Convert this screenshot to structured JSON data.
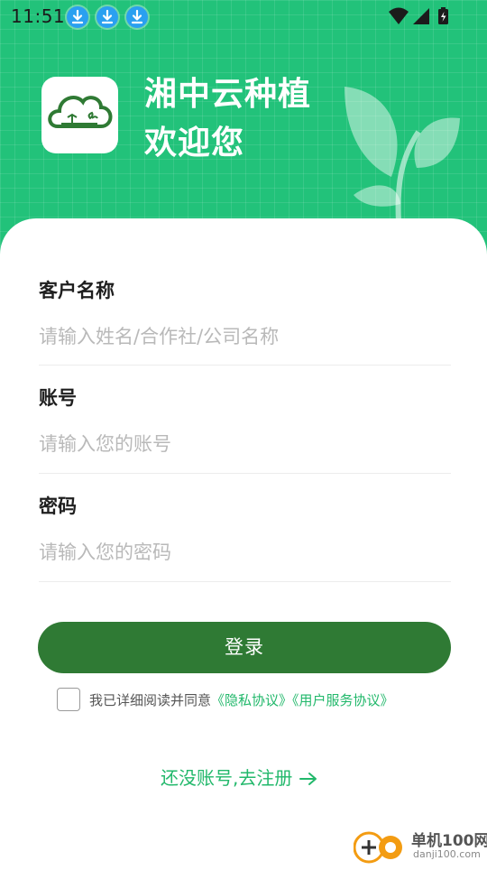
{
  "status_bar": {
    "time": "11:51",
    "notification_icons": [
      "download-icon",
      "download-icon",
      "download-icon"
    ],
    "right_icons": [
      "wifi-icon",
      "signal-icon",
      "battery-icon"
    ]
  },
  "header": {
    "app_name": "湘中云种植",
    "welcome": "欢迎您"
  },
  "form": {
    "customer_name": {
      "label": "客户名称",
      "placeholder": "请输入姓名/合作社/公司名称",
      "value": ""
    },
    "account": {
      "label": "账号",
      "placeholder": "请输入您的账号",
      "value": ""
    },
    "password": {
      "label": "密码",
      "placeholder": "请输入您的密码",
      "value": ""
    },
    "login_label": "登录"
  },
  "agreement": {
    "checked": false,
    "prefix": "我已详细阅读并同意",
    "privacy_link": "《隐私协议》",
    "service_link": "《用户服务协议》"
  },
  "register": {
    "label": "还没账号,去注册"
  },
  "watermark": {
    "main": "单机100网",
    "sub": "danji100.com"
  },
  "colors": {
    "brand_green": "#22c27a",
    "button_green": "#2f7a34",
    "link_green": "#22b86b"
  }
}
